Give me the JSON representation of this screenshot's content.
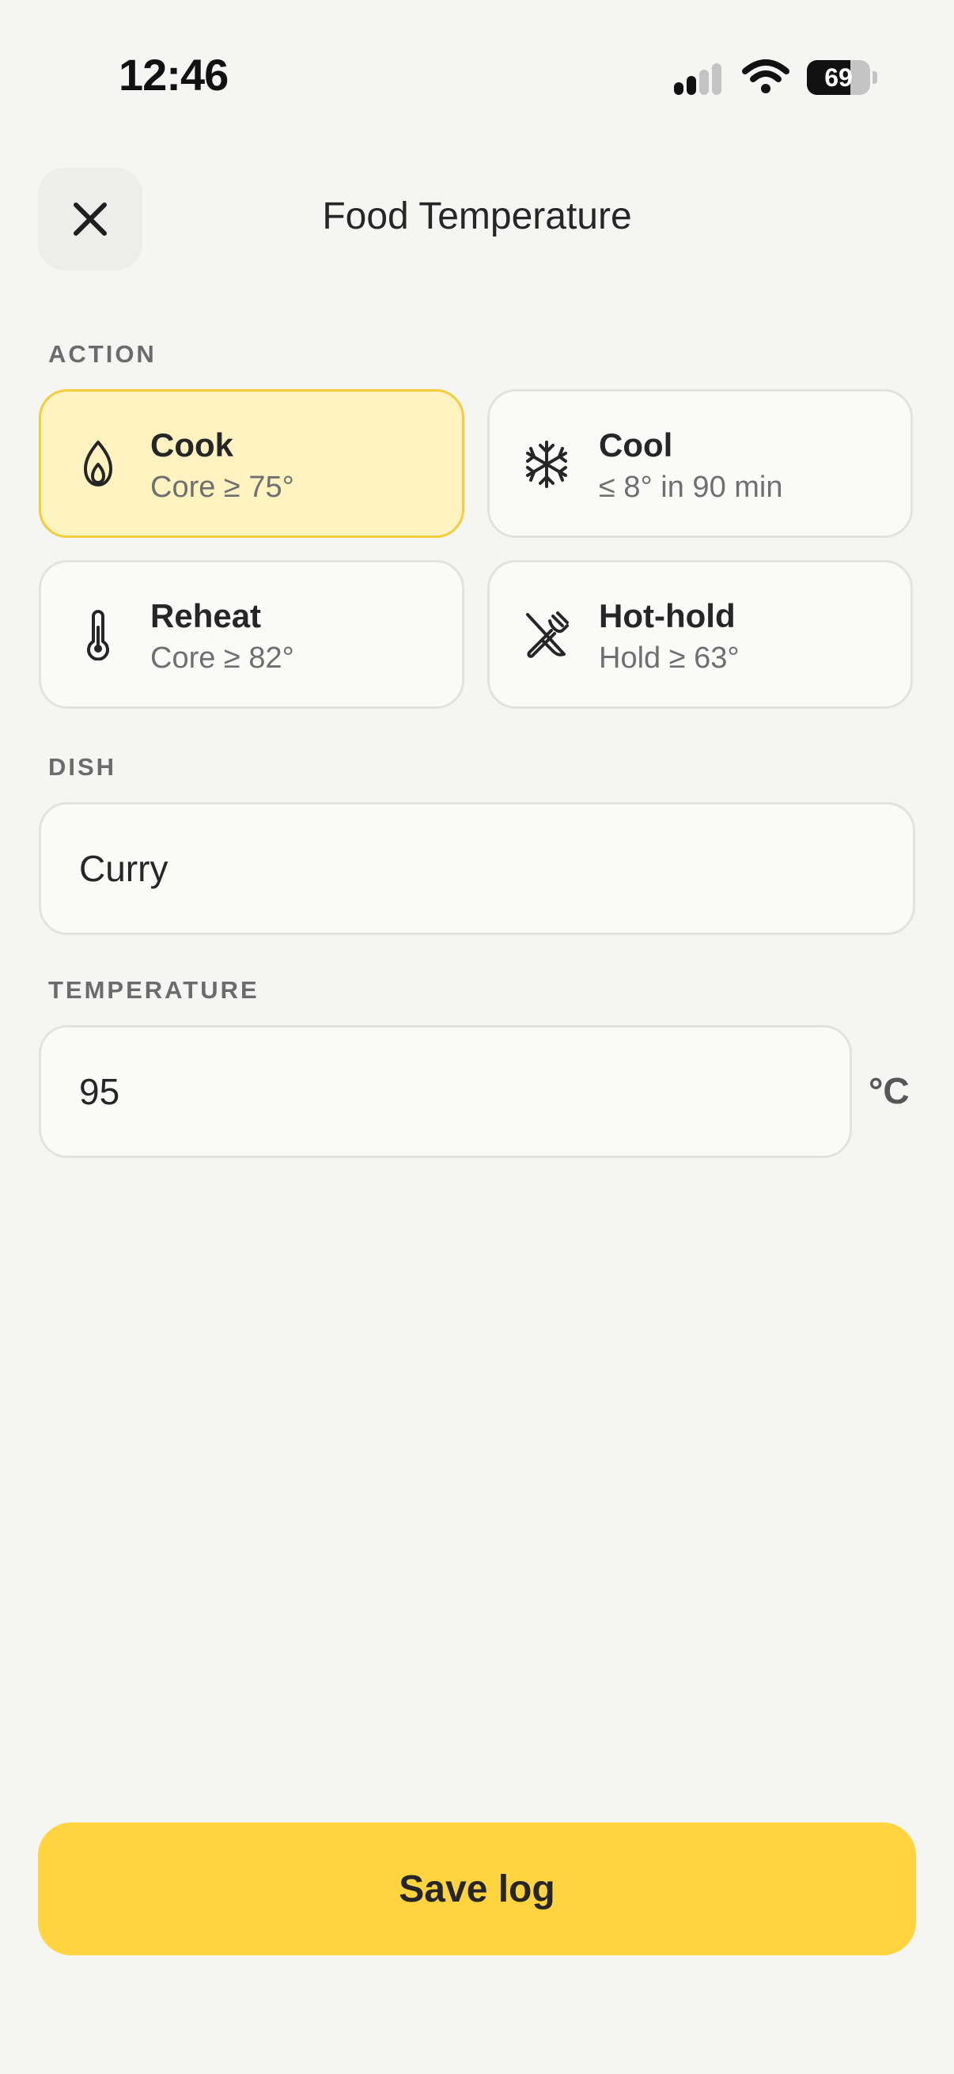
{
  "status_bar": {
    "time": "12:46",
    "battery_level": 69,
    "battery_text": "69",
    "signal_bars_active": 2,
    "icons": [
      "cellular-signal-icon",
      "wifi-icon",
      "battery-icon"
    ]
  },
  "header": {
    "title": "Food Temperature",
    "close_icon": "close-icon"
  },
  "action_section": {
    "label": "ACTION",
    "selected": "cook",
    "options": [
      {
        "id": "cook",
        "icon": "flame-icon",
        "title": "Cook",
        "subtitle": "Core ≥ 75°"
      },
      {
        "id": "cool",
        "icon": "snowflake-icon",
        "title": "Cool",
        "subtitle": "≤ 8° in 90 min"
      },
      {
        "id": "reheat",
        "icon": "thermometer-icon",
        "title": "Reheat",
        "subtitle": "Core ≥ 82°"
      },
      {
        "id": "hot-hold",
        "icon": "utensils-icon",
        "title": "Hot-hold",
        "subtitle": "Hold ≥ 63°"
      }
    ]
  },
  "dish_section": {
    "label": "DISH",
    "value": "Curry"
  },
  "temperature_section": {
    "label": "TEMPERATURE",
    "value": "95",
    "unit": "°C"
  },
  "footer": {
    "save_label": "Save log"
  },
  "colors": {
    "background": "#f5f5f3",
    "accent": "#ffd43f",
    "selected_card": "#fef3c0",
    "selected_border": "#f5cc3b",
    "text": "#262626",
    "muted_text": "#6f6f6f"
  }
}
